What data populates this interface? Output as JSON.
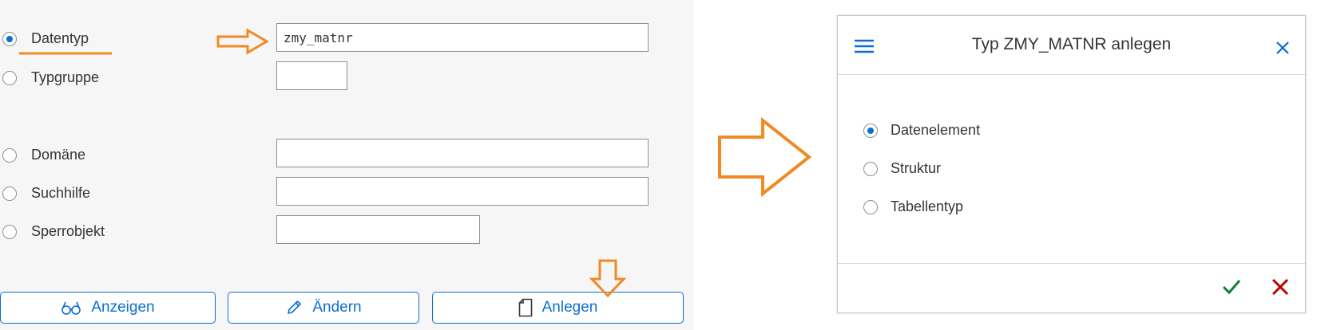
{
  "form": {
    "radios": [
      {
        "label": "Datentyp",
        "checked": true
      },
      {
        "label": "Typgruppe",
        "checked": false
      },
      {
        "label": "Domäne",
        "checked": false
      },
      {
        "label": "Suchhilfe",
        "checked": false
      },
      {
        "label": "Sperrobjekt",
        "checked": false
      }
    ],
    "datentyp_value": "zmy_matnr"
  },
  "buttons": {
    "anzeigen": "Anzeigen",
    "aendern": "Ändern",
    "anlegen": "Anlegen"
  },
  "dialog": {
    "title": "Typ ZMY_MATNR anlegen",
    "options": [
      {
        "label": "Datenelement",
        "checked": true
      },
      {
        "label": "Struktur",
        "checked": false
      },
      {
        "label": "Tabellentyp",
        "checked": false
      }
    ]
  },
  "colors": {
    "accent": "#0a6ed1",
    "annotation": "#f08a24",
    "confirm": "#107e3e",
    "cancel": "#bb0000"
  }
}
